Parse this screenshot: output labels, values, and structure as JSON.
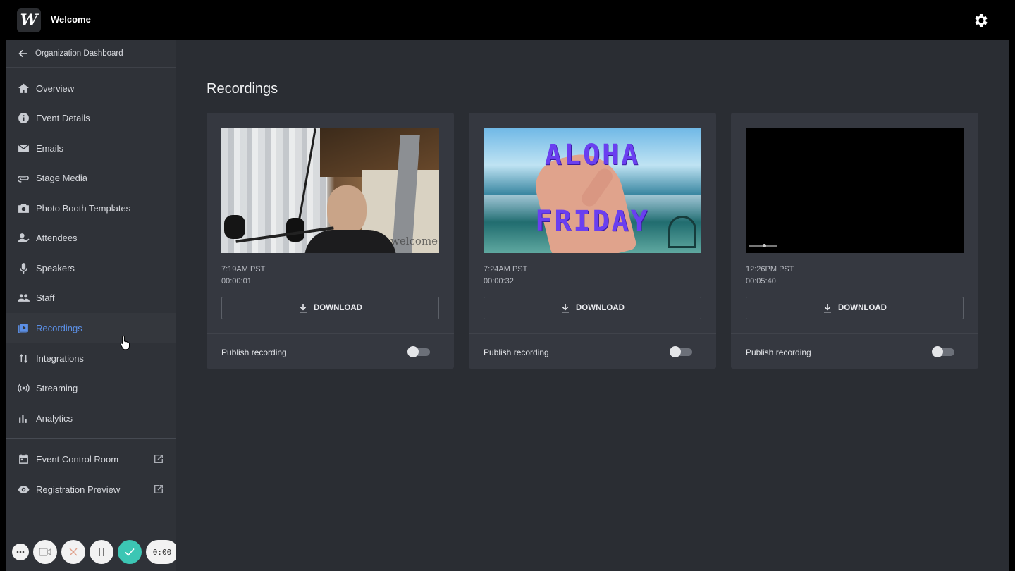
{
  "app": {
    "title": "Welcome",
    "logo_letter": "W"
  },
  "sidebar": {
    "back_label": "Organization Dashboard",
    "items": [
      {
        "label": "Overview",
        "icon": "home-icon"
      },
      {
        "label": "Event Details",
        "icon": "info-icon"
      },
      {
        "label": "Emails",
        "icon": "mail-icon"
      },
      {
        "label": "Stage Media",
        "icon": "clip-icon"
      },
      {
        "label": "Photo Booth Templates",
        "icon": "camera-icon"
      },
      {
        "label": "Attendees",
        "icon": "attendees-icon"
      },
      {
        "label": "Speakers",
        "icon": "mic-icon"
      },
      {
        "label": "Staff",
        "icon": "staff-icon"
      },
      {
        "label": "Recordings",
        "icon": "recordings-icon",
        "active": true
      },
      {
        "label": "Integrations",
        "icon": "integrations-icon"
      },
      {
        "label": "Streaming",
        "icon": "streaming-icon"
      },
      {
        "label": "Analytics",
        "icon": "analytics-icon"
      }
    ],
    "bottom_items": [
      {
        "label": "Event Control Room",
        "icon": "calendar-icon"
      },
      {
        "label": "Registration Preview",
        "icon": "eye-icon"
      }
    ]
  },
  "main": {
    "title": "Recordings",
    "recordings": [
      {
        "time": "7:19AM PST",
        "duration": "00:00:01",
        "download_label": "DOWNLOAD",
        "publish_label": "Publish recording",
        "published": false,
        "watermark": "welcome"
      },
      {
        "time": "7:24AM PST",
        "duration": "00:00:32",
        "download_label": "DOWNLOAD",
        "publish_label": "Publish recording",
        "published": false,
        "overlay_line1": "ALOHA",
        "overlay_line2": "FRIDAY"
      },
      {
        "time": "12:26PM PST",
        "duration": "00:05:40",
        "download_label": "DOWNLOAD",
        "publish_label": "Publish recording",
        "published": false
      }
    ]
  },
  "recorder": {
    "timer": "0:00"
  },
  "colors": {
    "accent": "#5b8fe6",
    "sidebar_bg": "#2f3238",
    "main_bg": "#2a2d33",
    "card_bg": "#353840",
    "confirm": "#3cc6b4"
  }
}
